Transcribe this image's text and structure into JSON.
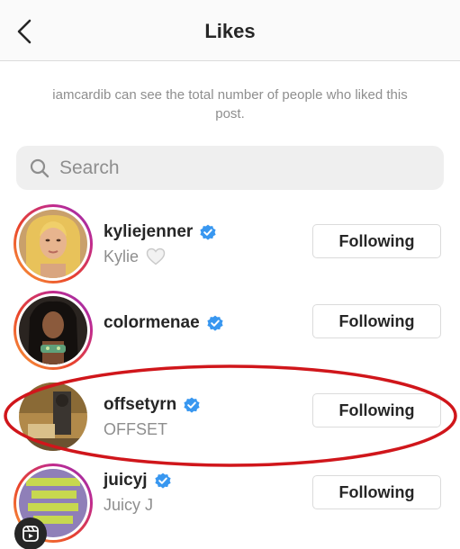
{
  "header": {
    "title": "Likes",
    "back_icon": "chevron-left-icon"
  },
  "notice": "iamcardib can see the total number of people who liked this post.",
  "search": {
    "placeholder": "Search",
    "value": ""
  },
  "users": [
    {
      "username": "kyliejenner",
      "full_name": "Kylie",
      "verified": true,
      "has_heart": true,
      "button": "Following"
    },
    {
      "username": "colormenae",
      "full_name": "",
      "verified": true,
      "has_heart": false,
      "button": "Following"
    },
    {
      "username": "offsetyrn",
      "full_name": "OFFSET",
      "verified": true,
      "has_heart": false,
      "button": "Following"
    },
    {
      "username": "juicyj",
      "full_name": "Juicy J",
      "verified": true,
      "has_heart": false,
      "button": "Following"
    }
  ],
  "colors": {
    "verified_blue": "#3897f0",
    "annotation_red": "#d0161b",
    "muted_text": "#8e8e8e"
  }
}
